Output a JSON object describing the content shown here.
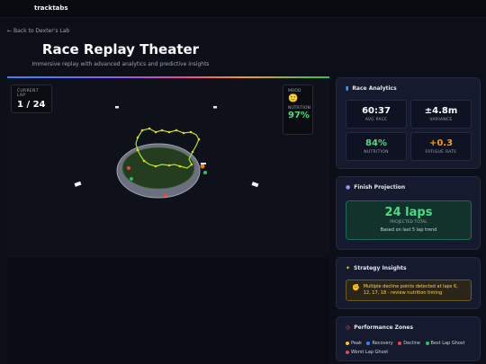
{
  "app": {
    "brand": "tracktabs"
  },
  "nav": {
    "back_label": "Back to Dexter's Lab"
  },
  "header": {
    "title": "Race Replay Theater",
    "subtitle": "Immersive replay with advanced analytics and predictive insights"
  },
  "theater": {
    "lap_label": "CURRENT LAP",
    "lap_value": "1 / 24",
    "mood_label": "MOOD",
    "mood_emoji": "🙂",
    "nutrition_label": "NUTRITION",
    "nutrition_value": "97%"
  },
  "analytics": {
    "title": "Race Analytics",
    "icon": "bar-chart-icon",
    "stats": [
      {
        "value": "60:37",
        "label": "AVG PACE",
        "color": "#ffffff"
      },
      {
        "value": "±4.8m",
        "label": "VARIANCE",
        "color": "#ffffff"
      },
      {
        "value": "84%",
        "label": "NUTRITION",
        "color": "#4ade80"
      },
      {
        "value": "+0.3",
        "label": "FATIGUE RATE",
        "color": "#f59e0b"
      }
    ]
  },
  "projection": {
    "title": "Finish Projection",
    "icon": "crystal-ball-icon",
    "value": "24 laps",
    "label": "PROJECTED TOTAL",
    "note": "Based on last 5 lap trend"
  },
  "strategy": {
    "title": "Strategy Insights",
    "icon": "lightbulb-icon",
    "insight_icon": "flexed-arm-icon",
    "insight": "Multiple decline points detected at laps 6, 12, 17, 18 - review nutrition timing"
  },
  "zones": {
    "title": "Performance Zones",
    "icon": "target-icon",
    "items": [
      {
        "label": "Peak",
        "color": "#facc15"
      },
      {
        "label": "Recovery",
        "color": "#3b82f6"
      },
      {
        "label": "Decline",
        "color": "#ef4444"
      },
      {
        "label": "Best Lap Ghost",
        "color": "#22c55e"
      },
      {
        "label": "Worst Lap Ghost",
        "color": "#ef4444"
      }
    ]
  },
  "colors": {
    "accent": "#4ade80",
    "warning": "#f59e0b",
    "panel": "#151a2e"
  }
}
